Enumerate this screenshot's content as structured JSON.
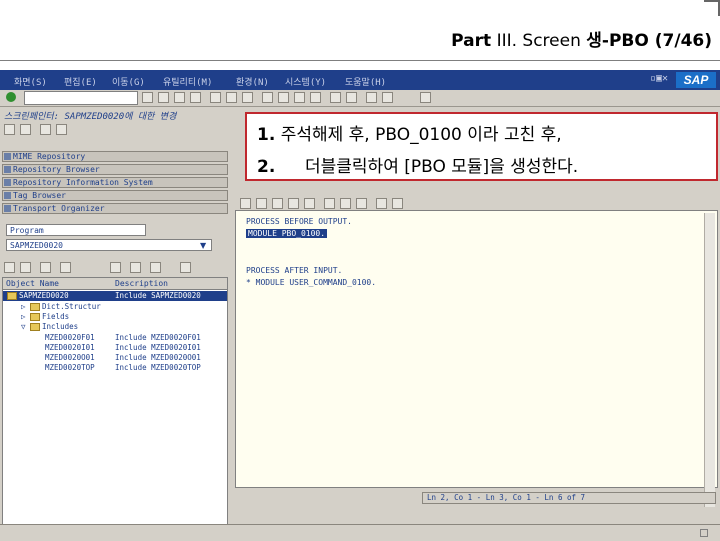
{
  "slide": {
    "title_part": "Part",
    "title_roman": "III.",
    "title_screen": "Screen",
    "title_korean": "생",
    "title_rest": "-PBO (7/46)"
  },
  "sap": {
    "menu": [
      "화면(S)",
      "편집(E)",
      "이동(G)",
      "유틸리티(M)",
      "환경(N)",
      "시스템(Y)",
      "도움말(H)"
    ],
    "subtitle": "스크린페인터: SAPMZED0020에 대한 변경",
    "logo": "SAP",
    "nav_items": [
      "MIME Repository",
      "Repository Browser",
      "Repository Information System",
      "Tag Browser",
      "Transport Organizer"
    ],
    "object_type": "Program",
    "object_name": "SAPMZED0020",
    "tree": {
      "col_name": "Object Name",
      "col_desc": "Description",
      "rows": [
        {
          "name": "SAPMZED0020",
          "desc": "Include SAPMZED0020"
        },
        {
          "name": "Dict.Structur",
          "desc": ""
        },
        {
          "name": "Fields",
          "desc": ""
        },
        {
          "name": "Includes",
          "desc": ""
        },
        {
          "name": "MZED0020F01",
          "desc": "Include MZED0020F01"
        },
        {
          "name": "MZED0020I01",
          "desc": "Include MZED0020I01"
        },
        {
          "name": "MZED0020O01",
          "desc": "Include MZED0020O01"
        },
        {
          "name": "MZED0020TOP",
          "desc": "Include MZED0020TOP"
        }
      ]
    },
    "code": {
      "line1": "PROCESS BEFORE OUTPUT.",
      "line2": "MODULE PBO_0100.",
      "line3": "PROCESS AFTER INPUT.",
      "line4": "* MODULE USER_COMMAND_0100."
    },
    "status": "Ln 2, Co 1 - Ln 3, Co 1 - Ln 6 of 7"
  },
  "callout": {
    "num1": "1.",
    "line1": "주석해제 후, PBO_0100 이라 고친 후,",
    "num2": "2.",
    "line2": "더블클릭하여 [PBO 모듈]을 생성한다."
  },
  "colors": {
    "sap_blue": "#1f3f8a",
    "callout_border": "#c0282e",
    "sap_gray": "#d4d0c8"
  }
}
